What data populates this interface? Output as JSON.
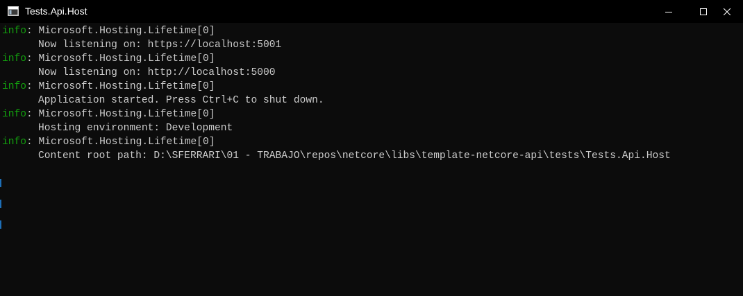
{
  "window": {
    "title": "Tests.Api.Host",
    "app_icon": "console-window-icon",
    "buttons": {
      "minimize_icon": "minimize-icon",
      "maximize_icon": "maximize-icon",
      "close_icon": "close-icon"
    }
  },
  "colors": {
    "background": "#0c0c0c",
    "titlebar": "#000000",
    "text": "#cccccc",
    "level": "#13a10e"
  },
  "log": [
    {
      "level": "info",
      "sep": ": ",
      "category": "Microsoft.Hosting.Lifetime[0]",
      "message": "Now listening on: https://localhost:5001"
    },
    {
      "level": "info",
      "sep": ": ",
      "category": "Microsoft.Hosting.Lifetime[0]",
      "message": "Now listening on: http://localhost:5000"
    },
    {
      "level": "info",
      "sep": ": ",
      "category": "Microsoft.Hosting.Lifetime[0]",
      "message": "Application started. Press Ctrl+C to shut down."
    },
    {
      "level": "info",
      "sep": ": ",
      "category": "Microsoft.Hosting.Lifetime[0]",
      "message": "Hosting environment: Development"
    },
    {
      "level": "info",
      "sep": ": ",
      "category": "Microsoft.Hosting.Lifetime[0]",
      "message": "Content root path: D:\\SFERRARI\\01 - TRABAJO\\repos\\netcore\\libs\\template-netcore-api\\tests\\Tests.Api.Host"
    }
  ]
}
